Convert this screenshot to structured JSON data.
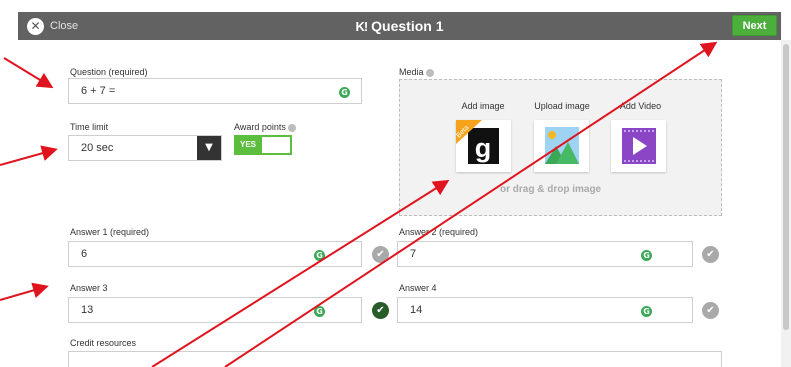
{
  "header": {
    "close_label": "Close",
    "logo_mark": "K!",
    "title": "Question 1",
    "next_label": "Next",
    "bg_color": "#626262",
    "next_color": "#4caf3c"
  },
  "question": {
    "label": "Question (required)",
    "value": "6 + 7 ="
  },
  "time_limit": {
    "label": "Time limit",
    "value": "20 sec"
  },
  "award_points": {
    "label": "Award points",
    "toggle_text": "YES",
    "on": true
  },
  "media": {
    "label": "Media",
    "options": [
      {
        "label": "Add image",
        "badge": "Beta",
        "icon": "getty-g-icon"
      },
      {
        "label": "Upload image",
        "icon": "landscape-image-icon"
      },
      {
        "label": "Add Video",
        "icon": "video-play-icon"
      }
    ],
    "getty_letter": "g",
    "drag_text": "or drag & drop image"
  },
  "answers": [
    {
      "label": "Answer 1 (required)",
      "value": "6",
      "correct": false
    },
    {
      "label": "Answer 2 (required)",
      "value": "7",
      "correct": false
    },
    {
      "label": "Answer 3",
      "value": "13",
      "correct": true
    },
    {
      "label": "Answer 4",
      "value": "14",
      "correct": false
    }
  ],
  "credit": {
    "label": "Credit resources"
  },
  "icons": {
    "grammar": "G",
    "check": "✔",
    "close": "✕",
    "dropdown": "▼"
  },
  "annotation_color": "#e0141e"
}
